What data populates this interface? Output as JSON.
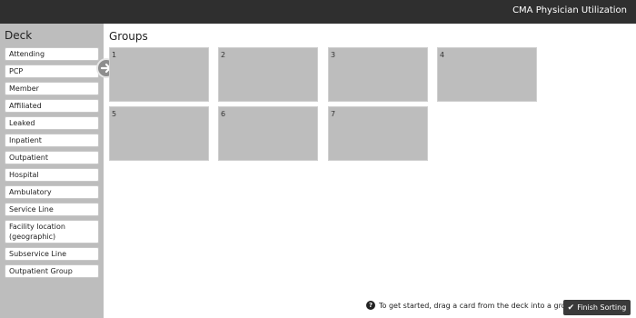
{
  "header": {
    "title": "CMA Physician Utilization"
  },
  "deck": {
    "title": "Deck",
    "cards": [
      "Attending",
      "PCP",
      "Member",
      "Affiliated",
      "Leaked",
      "Inpatient",
      "Outpatient",
      "Hospital",
      "Ambulatory",
      "Service Line",
      "Facility location (geographic)",
      "Subservice Line",
      "Outpatient Group"
    ]
  },
  "groups": {
    "title": "Groups",
    "labels": [
      "1",
      "2",
      "3",
      "4",
      "5",
      "6",
      "7"
    ]
  },
  "footer": {
    "hint_icon": "question-circle-icon",
    "hint": "To get started, drag a card from the deck into a group.",
    "finish_label": "Finish Sorting"
  }
}
